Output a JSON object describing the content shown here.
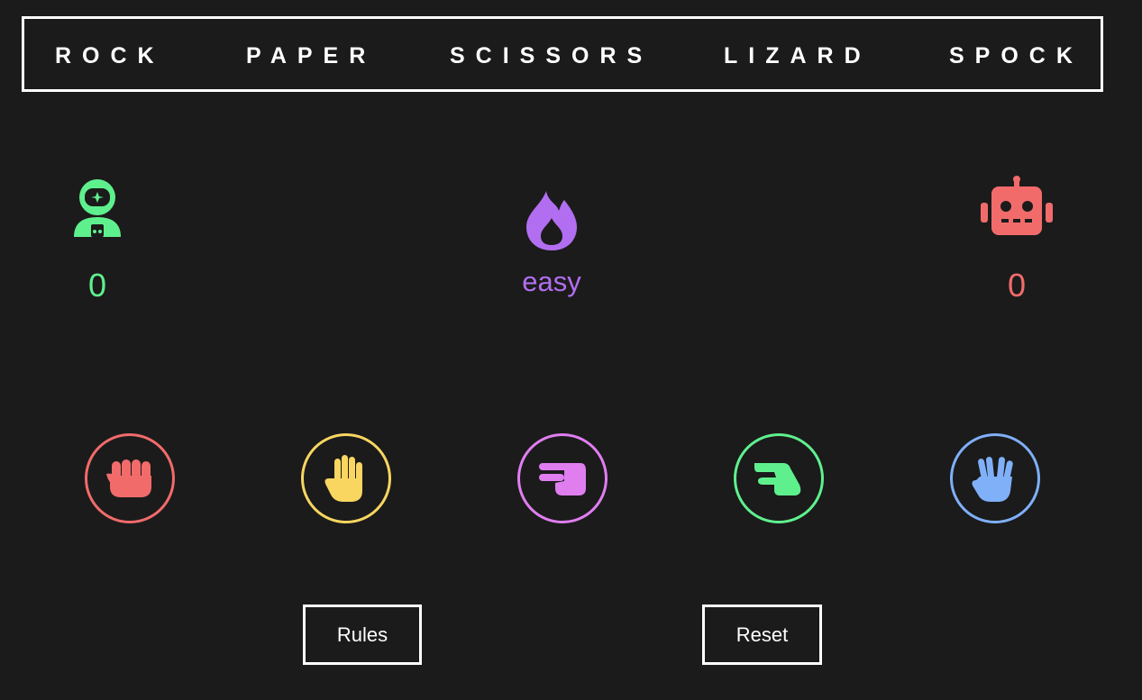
{
  "title": {
    "words": [
      "ROCK",
      "PAPER",
      "SCISSORS",
      "LIZARD",
      "SPOCK"
    ]
  },
  "player": {
    "icon": "astronaut-icon",
    "score": "0",
    "color": "#5ff08e"
  },
  "computer": {
    "icon": "robot-icon",
    "score": "0",
    "color": "#f26b6b"
  },
  "difficulty": {
    "icon": "flame-icon",
    "label": "easy",
    "color": "#b26ef0"
  },
  "choices": [
    {
      "name": "rock",
      "icon": "fist-icon",
      "color": "#f26b6b"
    },
    {
      "name": "paper",
      "icon": "open-hand-icon",
      "color": "#f8d660"
    },
    {
      "name": "scissors",
      "icon": "scissors-hand-icon",
      "color": "#e07ef0"
    },
    {
      "name": "lizard",
      "icon": "lizard-hand-icon",
      "color": "#5ff08e"
    },
    {
      "name": "spock",
      "icon": "vulcan-salute-icon",
      "color": "#7fb0f8"
    }
  ],
  "buttons": {
    "rules_label": "Rules",
    "reset_label": "Reset"
  }
}
